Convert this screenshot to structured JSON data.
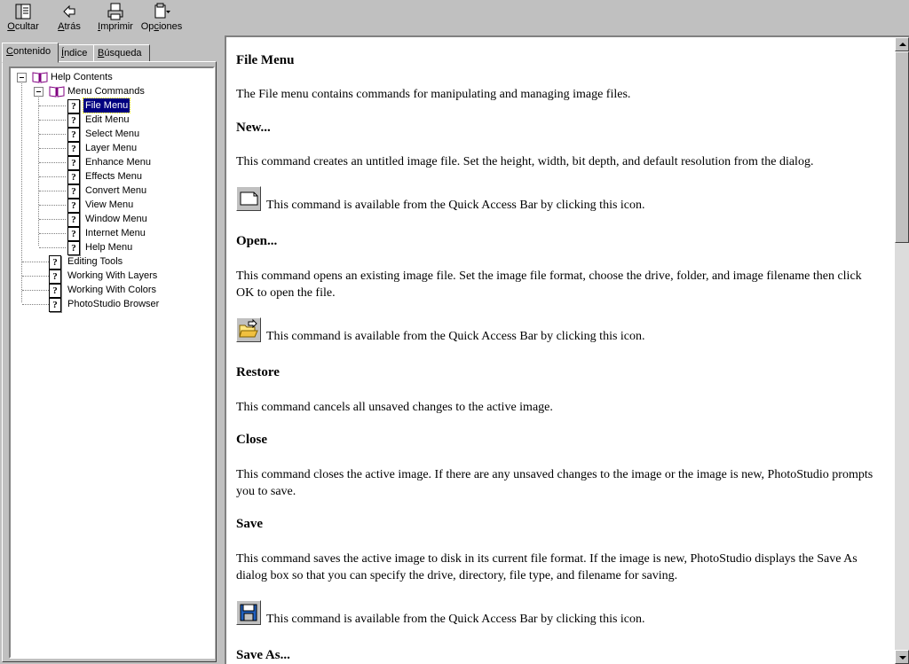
{
  "toolbar": {
    "hide": {
      "pre": "",
      "key": "O",
      "post": "cultar"
    },
    "back": {
      "pre": "",
      "key": "A",
      "post": "trás"
    },
    "print": {
      "pre": "",
      "key": "I",
      "post": "mprimir"
    },
    "options": {
      "pre": "Op",
      "key": "c",
      "post": "iones"
    }
  },
  "tabs": [
    {
      "pre": "",
      "key": "C",
      "post": "ontenido"
    },
    {
      "pre": "",
      "key": "Í",
      "post": "ndice"
    },
    {
      "pre": "",
      "key": "B",
      "post": "úsqueda"
    }
  ],
  "tree": {
    "items": [
      {
        "label": "Help Contents",
        "icon": "open-book-icon"
      },
      {
        "label": "Menu Commands",
        "icon": "open-book-icon"
      },
      {
        "label": "File Menu",
        "icon": "help-topic-icon"
      },
      {
        "label": "Edit Menu",
        "icon": "help-topic-icon"
      },
      {
        "label": "Select Menu",
        "icon": "help-topic-icon"
      },
      {
        "label": "Layer Menu",
        "icon": "help-topic-icon"
      },
      {
        "label": "Enhance Menu",
        "icon": "help-topic-icon"
      },
      {
        "label": "Effects Menu",
        "icon": "help-topic-icon"
      },
      {
        "label": "Convert Menu",
        "icon": "help-topic-icon"
      },
      {
        "label": "View Menu",
        "icon": "help-topic-icon"
      },
      {
        "label": "Window Menu",
        "icon": "help-topic-icon"
      },
      {
        "label": "Internet Menu",
        "icon": "help-topic-icon"
      },
      {
        "label": "Help Menu",
        "icon": "help-topic-icon"
      },
      {
        "label": "Editing Tools",
        "icon": "help-topic-icon"
      },
      {
        "label": "Working With Layers",
        "icon": "help-topic-icon"
      },
      {
        "label": "Working With Colors",
        "icon": "help-topic-icon"
      },
      {
        "label": "PhotoStudio Browser",
        "icon": "help-topic-icon"
      }
    ],
    "selected": "File Menu"
  },
  "content": {
    "title": "File Menu",
    "intro": "The File menu contains commands for manipulating and managing image files.",
    "new_heading": "New...",
    "new_desc": "This command creates an untitled image file. Set the height, width, bit depth, and default resolution from the dialog.",
    "quick_access_note": "This command is available from the Quick Access Bar by clicking this icon.",
    "open_heading": "Open...",
    "open_desc": "This command opens an existing image file. Set the image file format, choose the drive, folder, and image filename then click OK to open the file.",
    "restore_heading": "Restore",
    "restore_desc": "This command cancels all unsaved changes to the active image.",
    "close_heading": "Close",
    "close_desc": "This command closes the active image. If there are any unsaved changes to the image or the image is new, PhotoStudio prompts you to save.",
    "save_heading": "Save",
    "save_desc": "This command saves the active image to disk in its current file format. If the image is new, PhotoStudio displays the Save As dialog box so that you can specify the drive, directory, file type, and filename for saving.",
    "saveas_heading": "Save As..."
  },
  "colors": {
    "face": "#c0c0c0",
    "selection": "#000080",
    "content_bg": "#ffffff"
  }
}
